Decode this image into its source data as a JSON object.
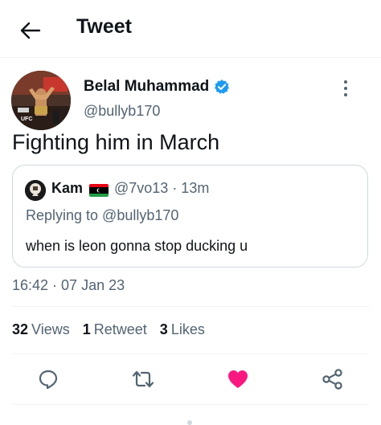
{
  "header": {
    "title": "Tweet",
    "back_icon": "arrow-left-icon"
  },
  "tweet": {
    "author_name": "Belal Muhammad",
    "author_handle": "@bullyb170",
    "verified_color": "#1d9bf0",
    "text": "Fighting him in March",
    "timestamp": "16:42 · 07 Jan 23",
    "avatar_lettering": "UFC",
    "quote": {
      "name": "Kam",
      "handle_time": "@7vo13 · 13m",
      "replying_to": "Replying to @bullyb170",
      "text": "when is leon gonna stop ducking u"
    },
    "stats": {
      "views_count": "32",
      "views_label": "Views",
      "retweets_count": "1",
      "retweets_label": "Retweet",
      "likes_count": "3",
      "likes_label": "Likes"
    }
  },
  "actions": {
    "reply_icon": "reply-icon",
    "retweet_icon": "retweet-icon",
    "like_icon": "heart-icon",
    "share_icon": "share-icon",
    "like_color": "#f91880"
  },
  "colors": {
    "text": "#0f1419",
    "secondary": "#536471",
    "border": "#cfd9de"
  }
}
